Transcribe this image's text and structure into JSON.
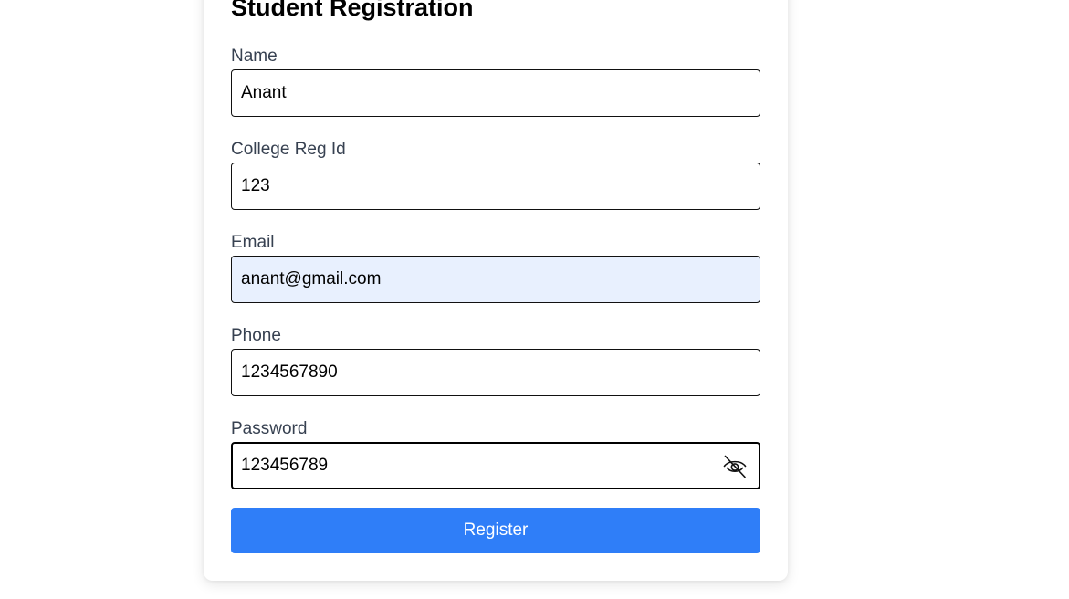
{
  "form": {
    "title": "Student Registration",
    "fields": [
      {
        "label": "Name",
        "value": "Anant"
      },
      {
        "label": "College Reg Id",
        "value": "123"
      },
      {
        "label": "Email",
        "value": "anant@gmail.com",
        "autofilled": true
      },
      {
        "label": "Phone",
        "value": "1234567890"
      },
      {
        "label": "Password",
        "value": "123456789",
        "icon": "eye-off-icon"
      }
    ],
    "submit_label": "Register"
  },
  "colors": {
    "primary": "#2f7ef8",
    "label": "#374151",
    "autofill": "#e8f0fe"
  }
}
